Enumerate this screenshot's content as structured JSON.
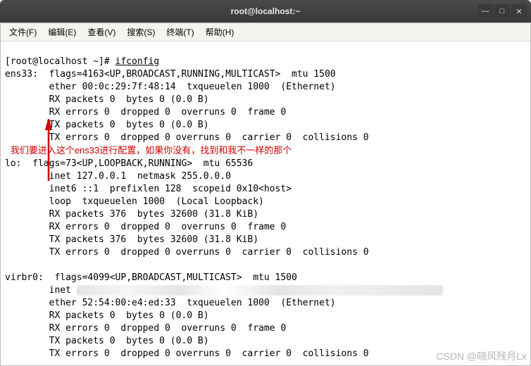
{
  "titlebar": {
    "title": "root@localhost:~"
  },
  "menu": {
    "file": "文件(F)",
    "edit": "编辑(E)",
    "view": "查看(V)",
    "search": "搜索(S)",
    "terminal": "终端(T)",
    "help": "帮助(H)"
  },
  "prompt": {
    "user_host": "[root@localhost ~]# ",
    "cmd": "ifconfig"
  },
  "ens33": {
    "name": "ens33:",
    "l1": "  flags=4163<UP,BROADCAST,RUNNING,MULTICAST>  mtu 1500",
    "l2": "        ether 00:0c:29:7f:48:14  txqueuelen 1000  (Ethernet)",
    "l3": "        RX packets 0  bytes 0 (0.0 B)",
    "l4": "        RX errors 0  dropped 0  overruns 0  frame 0",
    "l5": "        TX packets 0  bytes 0 (0.0 B)",
    "l6": "        TX errors 0  dropped 0 overruns 0  carrier 0  collisions 0"
  },
  "annotation": {
    "text": "我们要进入这个ens33进行配置，如果你没有，找到和我不一样的那个"
  },
  "lo": {
    "name": "lo:",
    "l1": "  flags=73<UP,LOOPBACK,RUNNING>  mtu 65536",
    "l2": "        inet 127.0.0.1  netmask 255.0.0.0",
    "l3": "        inet6 ::1  prefixlen 128  scopeid 0x10<host>",
    "l4": "        loop  txqueuelen 1000  (Local Loopback)",
    "l5": "        RX packets 376  bytes 32600 (31.8 KiB)",
    "l6": "        RX errors 0  dropped 0  overruns 0  frame 0",
    "l7": "        TX packets 376  bytes 32600 (31.8 KiB)",
    "l8": "        TX errors 0  dropped 0 overruns 0  carrier 0  collisions 0"
  },
  "virbr0": {
    "name": "virbr0:",
    "l1": "  flags=4099<UP,BROADCAST,MULTICAST>  mtu 1500",
    "l2a": "        inet ",
    "l3": "        ether 52:54:00:e4:ed:33  txqueuelen 1000  (Ethernet)",
    "l4": "        RX packets 0  bytes 0 (0.0 B)",
    "l5": "        RX errors 0  dropped 0  overruns 0  frame 0",
    "l6": "        TX packets 0  bytes 0 (0.0 B)",
    "l7": "        TX errors 0  dropped 0 overruns 0  carrier 0  collisions 0"
  },
  "watermark": {
    "text": "CSDN @晓风残月Lx"
  }
}
